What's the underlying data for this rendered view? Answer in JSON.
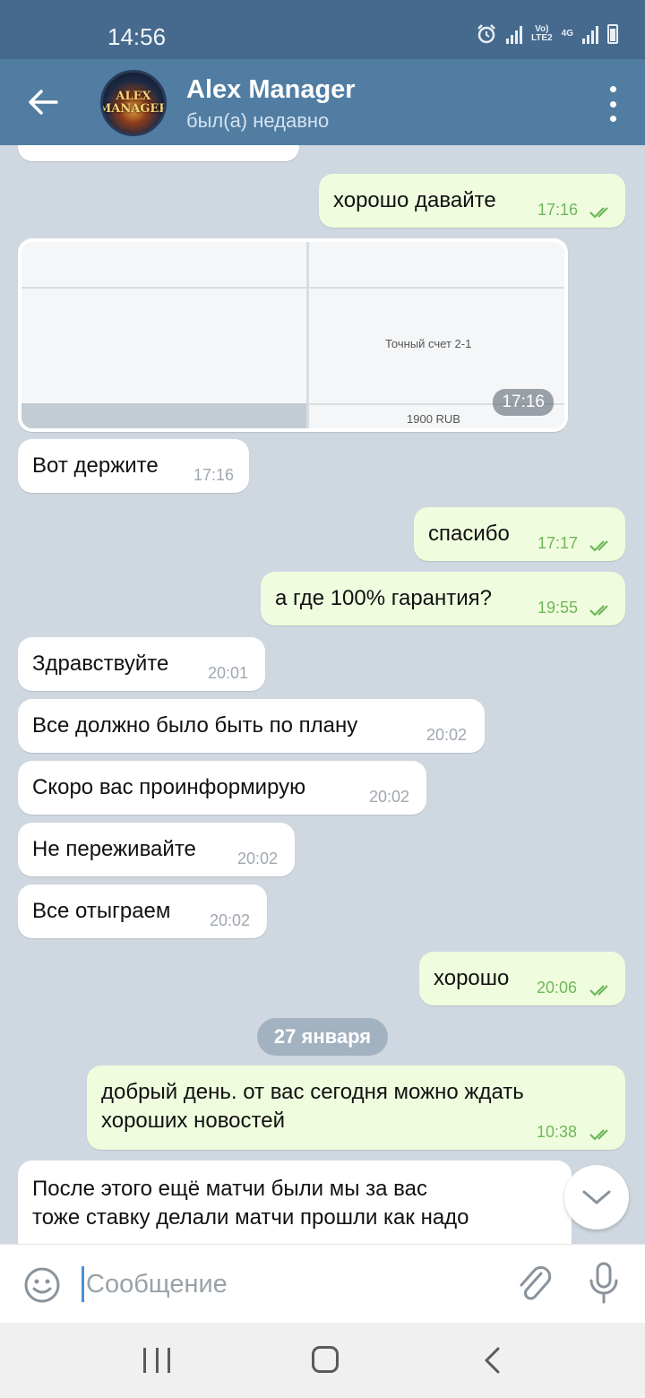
{
  "status_bar": {
    "time": "14:56",
    "volte": "Vo)",
    "lte": "LTE2",
    "network": "4G"
  },
  "header": {
    "title": "Alex Manager",
    "subtitle": "был(а) недавно",
    "avatar_text": "ALEX MANAGER"
  },
  "photo_message": {
    "cell1": "Точный счет 2-1",
    "cell2": "1900 RUB",
    "time": "17:16"
  },
  "messages": [
    {
      "dir": "out",
      "text": "хорошо давайте",
      "time": "17:16"
    },
    {
      "dir": "in",
      "text": "Вот держите",
      "time": "17:16"
    },
    {
      "dir": "out",
      "text": "спасибо",
      "time": "17:17"
    },
    {
      "dir": "out",
      "text": "а где 100% гарантия?",
      "time": "19:55"
    },
    {
      "dir": "in",
      "text": "Здравствуйте",
      "time": "20:01"
    },
    {
      "dir": "in",
      "text": "Все должно было быть по плану",
      "time": "20:02"
    },
    {
      "dir": "in",
      "text": "Скоро вас проинформирую",
      "time": "20:02"
    },
    {
      "dir": "in",
      "text": "Не переживайте",
      "time": "20:02"
    },
    {
      "dir": "in",
      "text": "Все отыграем",
      "time": "20:02"
    },
    {
      "dir": "out",
      "text": "хорошо",
      "time": "20:06"
    },
    {
      "dir": "out",
      "text_line1": "добрый день. от вас сегодня можно ждать",
      "text_line2": "хороших новостей",
      "time": "10:38"
    },
    {
      "dir": "in",
      "text_line1": "После этого ещё матчи были мы за вас",
      "text_line2": "тоже ставку делали матчи прошли как надо"
    }
  ],
  "date_separator": "27 января",
  "input": {
    "placeholder": "Сообщение"
  }
}
